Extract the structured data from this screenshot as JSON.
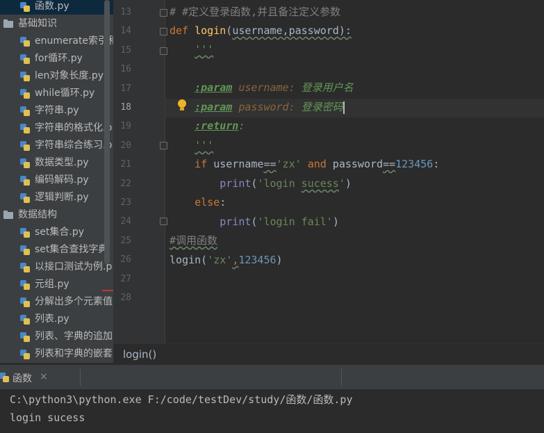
{
  "project_tree": {
    "items": [
      {
        "label": "函数.py",
        "type": "py"
      },
      {
        "label": "基础知识",
        "type": "dir"
      },
      {
        "label": "enumerate索引和",
        "type": "py"
      },
      {
        "label": "for循环.py",
        "type": "py"
      },
      {
        "label": "len对象长度.py",
        "type": "py"
      },
      {
        "label": "while循环.py",
        "type": "py"
      },
      {
        "label": "字符串.py",
        "type": "py"
      },
      {
        "label": "字符串的格式化.p",
        "type": "py"
      },
      {
        "label": "字符串综合练习.p",
        "type": "py"
      },
      {
        "label": "数据类型.py",
        "type": "py"
      },
      {
        "label": "编码解码.py",
        "type": "py"
      },
      {
        "label": "逻辑判断.py",
        "type": "py"
      },
      {
        "label": "数据结构",
        "type": "dir"
      },
      {
        "label": "set集合.py",
        "type": "py"
      },
      {
        "label": "set集合查找字典",
        "type": "py"
      },
      {
        "label": "以接口测试为例.p",
        "type": "py"
      },
      {
        "label": "元组.py",
        "type": "py"
      },
      {
        "label": "分解出多个元素值",
        "type": "py"
      },
      {
        "label": "列表.py",
        "type": "py"
      },
      {
        "label": "列表、字典的追加",
        "type": "py"
      },
      {
        "label": "列表和字典的嵌套",
        "type": "py"
      }
    ]
  },
  "editor": {
    "line_numbers": [
      "13",
      "14",
      "15",
      "16",
      "17",
      "18",
      "19",
      "20",
      "21",
      "22",
      "23",
      "24",
      "25",
      "26",
      "27",
      "28"
    ],
    "current_line": "18",
    "code": {
      "l13": "# #定义登录函数,并且备注定义参数",
      "l14_def": "def",
      "l14_name": "login",
      "l14_open": "(",
      "l14_params": "username,password",
      "l14_close": "):",
      "l15": "'''",
      "l17_tag": ":param",
      "l17_name": "username:",
      "l17_desc": "登录用户名",
      "l18_tag": ":param",
      "l18_name": "password:",
      "l18_desc": "登录密码",
      "l19_tag": ":return",
      "l19_colon": ":",
      "l20": "'''",
      "l21_if": "if",
      "l21_a": " username",
      "l21_eq1": "==",
      "l21_str": "'zx'",
      "l21_and": "and",
      "l21_b": " password",
      "l21_eq2": "==",
      "l21_num": "123456",
      "l21_end": ":",
      "l22_print": "print",
      "l22_open": "(",
      "l22_str1": "'login ",
      "l22_str2": "sucess",
      "l22_str3": "'",
      "l22_close": ")",
      "l23": "else",
      "l23_colon": ":",
      "l24_print": "print",
      "l24_open": "(",
      "l24_str": "'login fail'",
      "l24_close": ")",
      "l25": "#调用函数",
      "l26_call": "login",
      "l26_open": "(",
      "l26_str": "'zx'",
      "l26_comma": ",",
      "l26_num": "123456",
      "l26_close": ")"
    }
  },
  "breadcrumb": {
    "label": "login()"
  },
  "run_panel": {
    "tab_label": "函数",
    "close_glyph": "×",
    "output": [
      "C:\\python3\\python.exe F:/code/testDev/study/函数/函数.py",
      "login sucess"
    ]
  },
  "colors": {
    "keyword": "#cc7832",
    "function": "#ffc66d",
    "string": "#6a8759",
    "number": "#6897bb",
    "docstring": "#629755"
  }
}
